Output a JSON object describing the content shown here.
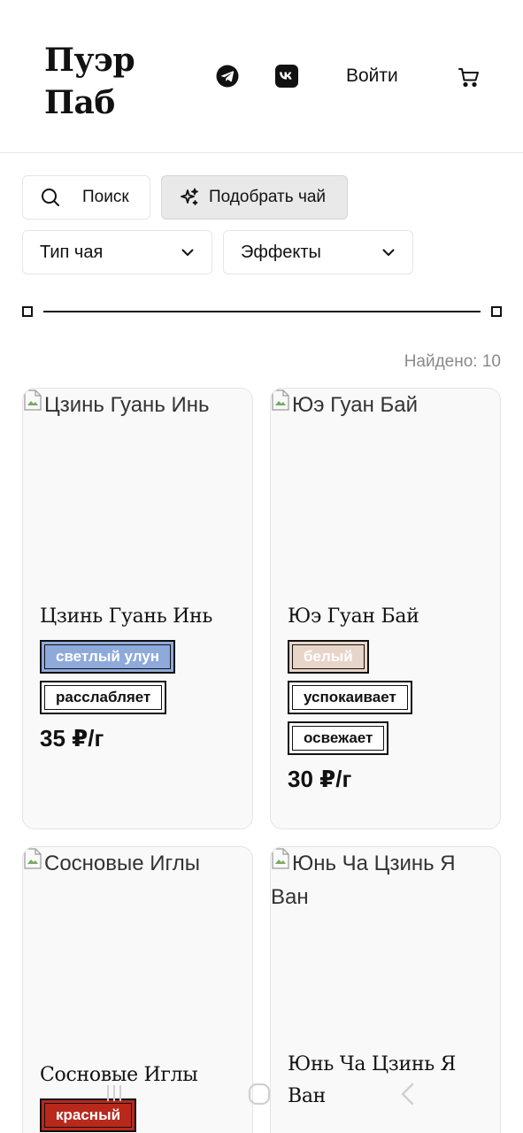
{
  "header": {
    "logo_line1": "Пуэр",
    "logo_line2": "Паб",
    "login_label": "Войти"
  },
  "toolbar": {
    "search_label": "Поиск",
    "pick_tea_label": "Подобрать чай"
  },
  "filters": {
    "tea_type_label": "Тип чая",
    "effects_label": "Эффекты"
  },
  "results": {
    "found_text": "Найдено: 10"
  },
  "products": [
    {
      "alt": "Цзинь Гуань Инь",
      "name": "Цзинь Гуань Инь",
      "type_tag": "светлый улун",
      "type_color": "#8eaadb",
      "effects": [
        "расслабляет"
      ],
      "price": "35 ₽/г"
    },
    {
      "alt": "Юэ Гуан Бай",
      "name": "Юэ Гуан Бай",
      "type_tag": "белый",
      "type_color": "#e8d5c9",
      "effects": [
        "успокаивает",
        "освежает"
      ],
      "price": "30 ₽/г"
    },
    {
      "alt": "Сосновые Иглы",
      "name": "Сосновые Иглы",
      "type_tag": "красный",
      "type_color": "#b8291c",
      "effects": [],
      "price": ""
    },
    {
      "alt": "Юнь Ча Цзинь Я Ван",
      "name": "Юнь Ча Цзинь Я Ван",
      "type_tag": "",
      "type_color": "",
      "effects": [],
      "price": ""
    }
  ],
  "icons": {
    "telegram": "telegram-icon",
    "vk": "vk-icon",
    "cart": "cart-icon",
    "search": "search-icon",
    "sparkle": "sparkle-icon",
    "chevron": "chevron-down-icon"
  }
}
